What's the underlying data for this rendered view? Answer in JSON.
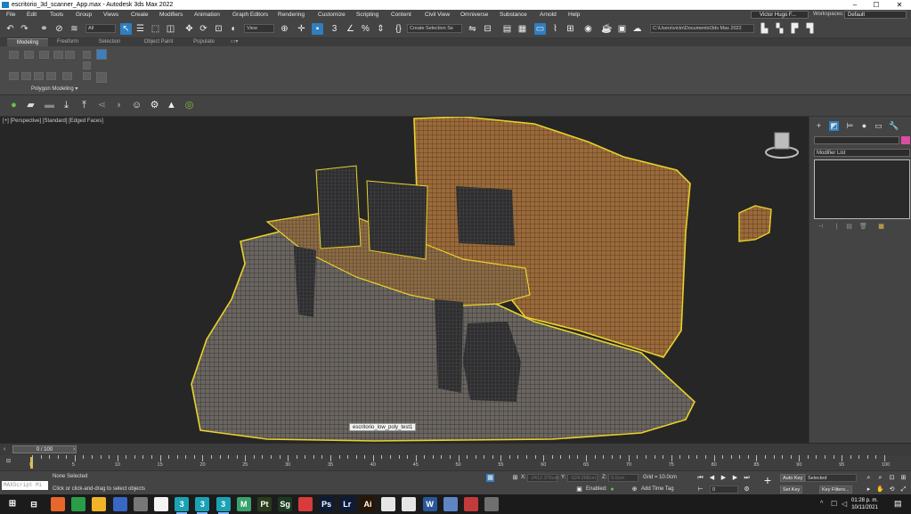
{
  "window": {
    "title": "escritorio_3d_scanner_App.max - Autodesk 3ds Max 2022",
    "minimize": "–",
    "maximize": "☐",
    "close": "✕"
  },
  "menu": {
    "items": [
      "File",
      "Edit",
      "Tools",
      "Group",
      "Views",
      "Create",
      "Modifiers",
      "Animation",
      "Graph Editors",
      "Rendering",
      "Customize",
      "Scripting",
      "Content",
      "Civil View",
      "Omniverse",
      "Substance",
      "Arnold",
      "Help"
    ],
    "user": "Victor Hugo F...",
    "workspaces_label": "Workspaces:",
    "workspace": "Default"
  },
  "toolbar": {
    "selection_filter": "All",
    "ref_coord": "View",
    "create_selection_set": "Create Selection Se",
    "project_path": "C:\\Users\\victo\\Documents\\3ds Max 2022"
  },
  "ribbon": {
    "tabs": [
      "Modeling",
      "Freeform",
      "Selection",
      "Object Paint",
      "Populate"
    ],
    "active_tab": "Modeling",
    "panel_label": "Polygon Modeling ▾"
  },
  "viewport": {
    "label": "[+] [Perspective] [Standard] [Edged Faces]",
    "object_tooltip": "escritorio_low_poly_test1"
  },
  "command_panel": {
    "modifier_list": "Modifier List",
    "color_swatch": "#d94ea3"
  },
  "time_slider": {
    "frame": "0 / 100",
    "ticks": [
      "0",
      "5",
      "10",
      "15",
      "20",
      "25",
      "30",
      "35",
      "40",
      "45",
      "50",
      "55",
      "60",
      "65",
      "70",
      "75",
      "80",
      "85",
      "90",
      "95",
      "100"
    ]
  },
  "status": {
    "maxscript": "MAXScript Mi",
    "selection": "None Selected",
    "prompt": "Click or click-and-drag to select objects",
    "x_label": "X:",
    "x_value": "-2412.376cm",
    "y_label": "Y:",
    "y_value": "-524.268cm",
    "z_label": "Z:",
    "z_value": "0.0cm",
    "grid": "Grid = 10.0cm",
    "enabled": "Enabled:",
    "add_time_tag": "Add Time Tag",
    "auto_key": "Auto Key",
    "set_key": "Set Key",
    "key_mode": "Selected",
    "key_filters": "Key Filters...",
    "frame_field": "0"
  },
  "taskbar": {
    "time": "01:28 p. m.",
    "date": "10/11/2021",
    "apps": [
      {
        "label": "",
        "color": "#e8672b"
      },
      {
        "label": "",
        "color": "#2a9d48"
      },
      {
        "label": "",
        "color": "#f0b429"
      },
      {
        "label": "",
        "color": "#3a66c4"
      },
      {
        "label": "",
        "color": "#777777"
      },
      {
        "label": "",
        "color": "#f4f4f4"
      },
      {
        "label": "3",
        "color": "#19a3b5"
      },
      {
        "label": "3",
        "color": "#19a3b5"
      },
      {
        "label": "3",
        "color": "#19a3b5"
      },
      {
        "label": "M",
        "color": "#36a36a"
      },
      {
        "label": "Pt",
        "color": "#2b3a1a"
      },
      {
        "label": "Sg",
        "color": "#1c3a22"
      },
      {
        "label": "",
        "color": "#d83b3b"
      },
      {
        "label": "Ps",
        "color": "#0d1b3a"
      },
      {
        "label": "Lr",
        "color": "#0d1b3a"
      },
      {
        "label": "Ai",
        "color": "#2a1500"
      },
      {
        "label": "",
        "color": "#e5e5e5"
      },
      {
        "label": "",
        "color": "#e5e5e5"
      },
      {
        "label": "W",
        "color": "#2b579a"
      },
      {
        "label": "",
        "color": "#5e86c5"
      },
      {
        "label": "",
        "color": "#c23b3b"
      },
      {
        "label": "",
        "color": "#6f6f6f"
      }
    ]
  }
}
